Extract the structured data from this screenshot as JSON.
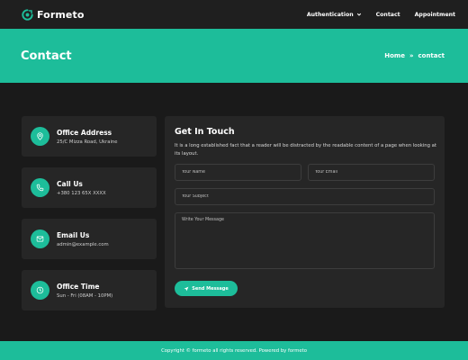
{
  "header": {
    "brand": "Formeto",
    "nav": [
      {
        "label": "Authentication",
        "has_dropdown": true
      },
      {
        "label": "Contact"
      },
      {
        "label": "Appointment"
      }
    ]
  },
  "banner": {
    "title": "Contact",
    "breadcrumb": {
      "home": "Home",
      "separator": "»",
      "current": "contact"
    }
  },
  "info_cards": [
    {
      "icon": "map-pin-icon",
      "title": "Office Address",
      "text": "25/C Mizza Road, Ukraine"
    },
    {
      "icon": "phone-icon",
      "title": "Call Us",
      "text": "+380 123 65X XXXX"
    },
    {
      "icon": "mail-icon",
      "title": "Email Us",
      "text": "admin@example.com"
    },
    {
      "icon": "clock-icon",
      "title": "Office Time",
      "text": "Sun - Fri (08AM - 10PM)"
    }
  ],
  "form": {
    "title": "Get In Touch",
    "description": "It is a long established fact that a reader will be distracted by the readable content of a page when looking at its layout.",
    "name_placeholder": "Your Name",
    "email_placeholder": "Your Email",
    "subject_placeholder": "Your Subject",
    "message_placeholder": "Write Your Message",
    "send_label": "Send Message"
  },
  "footer": {
    "text": "Copyright © formeto all rights reserved. Powered by formeto"
  },
  "colors": {
    "accent": "#1dbd9a",
    "background": "#1a1a1a",
    "panel": "#262626"
  }
}
